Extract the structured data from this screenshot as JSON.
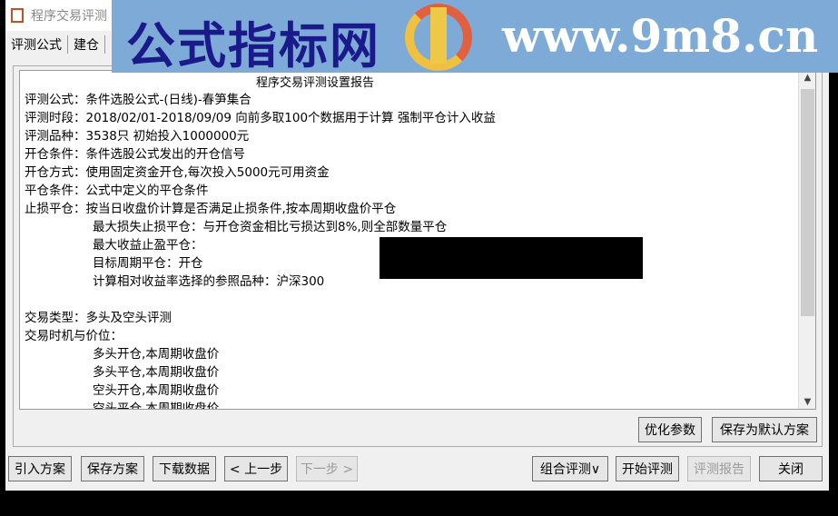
{
  "window": {
    "title": "程序交易评测"
  },
  "tabs": [
    "评测公式",
    "建仓"
  ],
  "watermark": {
    "text_cn": "公式指标网",
    "url": "www.9m8.cn"
  },
  "report": {
    "title": "程序交易评测设置报告",
    "lines": [
      "评测公式：条件选股公式-(日线)-春笋集合",
      "评测时段：2018/02/01-2018/09/09 向前多取100个数据用于计算 强制平仓计入收益",
      "评测品种：3538只 初始投入1000000元",
      "开仓条件：条件选股公式发出的开仓信号",
      "开仓方式：使用固定资金开仓,每次投入5000元可用资金",
      "平仓条件：公式中定义的平仓条件",
      "止损平仓：按当日收盘价计算是否满足止损条件,按本周期收盘价平仓"
    ],
    "indented": [
      "最大损失止损平仓：与开仓资金相比亏损达到8%,则全部数量平仓",
      "最大收益止盈平仓：",
      "目标周期平仓：开仓",
      "计算相对收益率选择的参照品种：沪深300"
    ],
    "lines2": [
      "交易类型：多头及空头评测",
      "交易时机与价位："
    ],
    "indented2": [
      "多头开仓,本周期收盘价",
      "多头平仓,本周期收盘价",
      "空头开仓,本周期收盘价",
      "空头平仓,本周期收盘价"
    ]
  },
  "buttons": {
    "optimize": "优化参数",
    "save_default": "保存为默认方案",
    "import": "引入方案",
    "save": "保存方案",
    "download": "下载数据",
    "prev": "< 上一步",
    "next": "下一步 >",
    "combo": "组合评测∨",
    "start": "开始评测",
    "report": "评测报告",
    "close": "关闭"
  }
}
